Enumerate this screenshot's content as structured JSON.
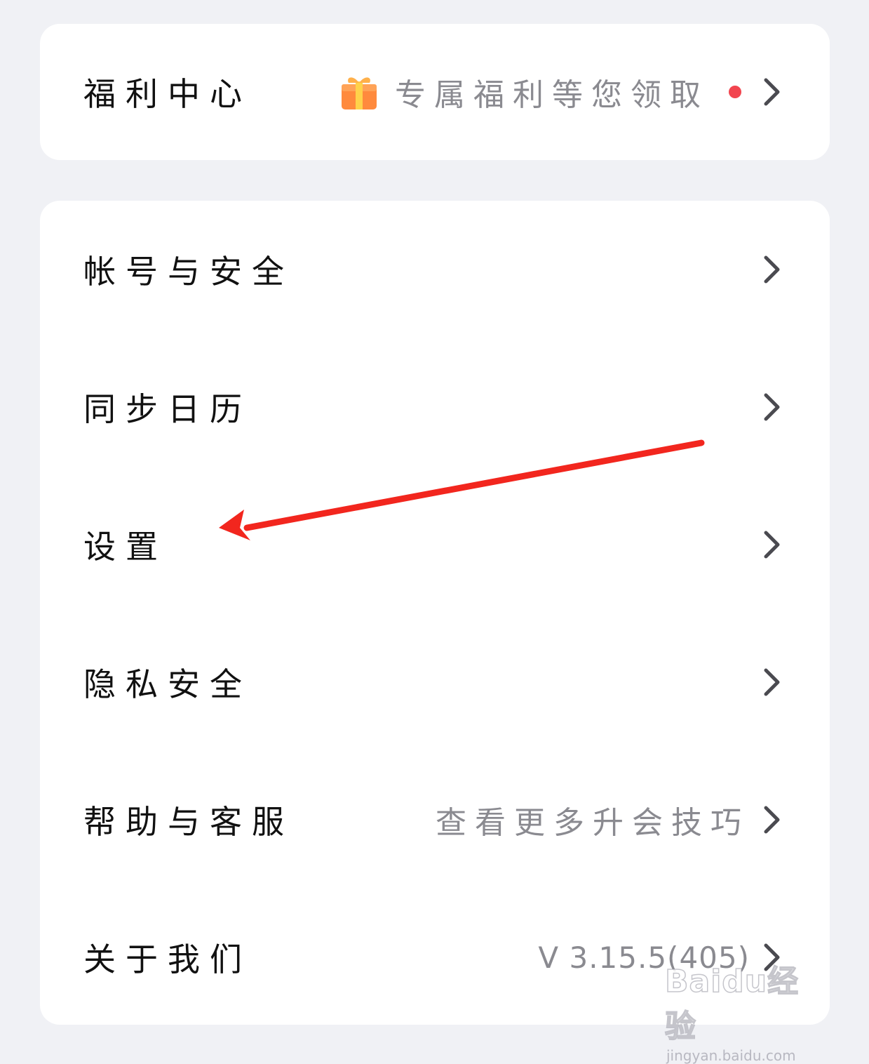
{
  "welfare": {
    "label": "福利中心",
    "value": "专属福利等您领取",
    "has_badge": true
  },
  "menu": {
    "items": [
      {
        "label": "帐号与安全",
        "value": ""
      },
      {
        "label": "同步日历",
        "value": ""
      },
      {
        "label": "设置",
        "value": ""
      },
      {
        "label": "隐私安全",
        "value": ""
      },
      {
        "label": "帮助与客服",
        "value": "查看更多升会技巧"
      },
      {
        "label": "关于我们",
        "value": "V 3.15.5(405)"
      }
    ]
  },
  "annotation": {
    "type": "red-arrow",
    "color": "#f2261e",
    "target": "设置"
  },
  "watermark": {
    "logo": "Baidu经验",
    "url": "jingyan.baidu.com"
  },
  "colors": {
    "background": "#f0f1f5",
    "card": "#ffffff",
    "text_primary": "#111111",
    "text_secondary": "#8a8a90",
    "chevron": "#4a4a50",
    "badge": "#f2454f"
  }
}
